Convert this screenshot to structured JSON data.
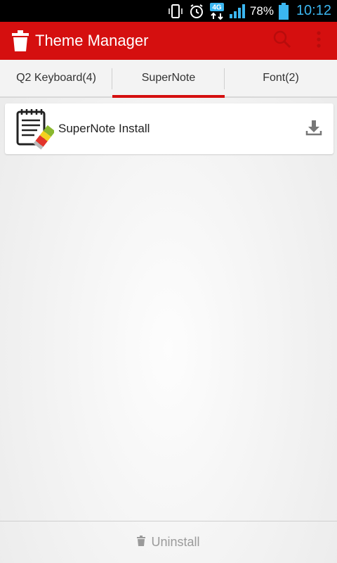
{
  "status_bar": {
    "network": "4G",
    "battery_percent": "78%",
    "time": "10:12"
  },
  "action_bar": {
    "title": "Theme Manager",
    "icons": [
      "trash-icon",
      "search-icon",
      "overflow-menu-icon"
    ]
  },
  "tabs": [
    {
      "label": "Q2 Keyboard(4)",
      "active": false
    },
    {
      "label": "SuperNote",
      "active": true
    },
    {
      "label": "Font(2)",
      "active": false
    }
  ],
  "items": [
    {
      "label": "SuperNote Install",
      "icon": "supernote-notepad-icon",
      "action_icon": "download-icon"
    }
  ],
  "bottom_bar": {
    "label": "Uninstall",
    "icon": "trash-icon"
  },
  "colors": {
    "accent": "#d50f0f",
    "clock": "#3bb6f0",
    "status_bar_bg": "#000000"
  }
}
